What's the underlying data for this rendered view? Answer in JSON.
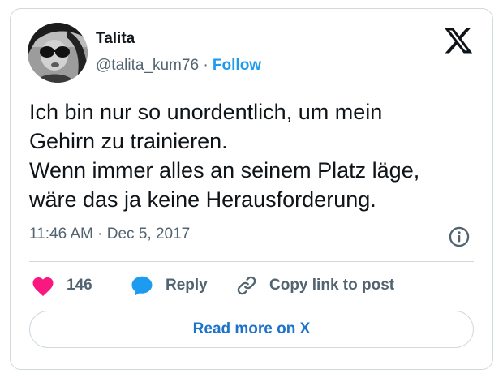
{
  "author": {
    "name": "Talita",
    "handle": "@talita_kum76",
    "separator": "·",
    "follow_label": "Follow"
  },
  "tweet": {
    "lines": [
      "Ich bin nur so unordentlich, um mein",
      "Gehirn zu trainieren.",
      "Wenn immer alles an seinem Platz läge,",
      "wäre das ja keine Herausforderung."
    ],
    "timestamp": "11:46 AM · Dec 5, 2017"
  },
  "actions": {
    "like_count": "146",
    "reply_label": "Reply",
    "copy_link_label": "Copy link to post"
  },
  "read_more_label": "Read more on X",
  "colors": {
    "accent": "#1d9bf0",
    "like": "#f91880",
    "muted": "#536471",
    "border": "#cfd9de"
  },
  "icons": [
    "x-logo-icon",
    "info-icon",
    "heart-icon",
    "reply-bubble-icon",
    "link-icon"
  ]
}
